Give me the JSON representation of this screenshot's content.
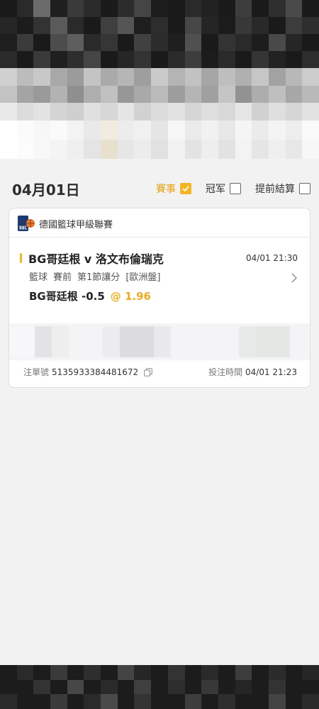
{
  "header": {
    "top_blocks": [
      "#1a1a1a",
      "#2a2a2a",
      "#6b6b6b",
      "#1f1f1f",
      "#3a3a3a",
      "#2b2b2b",
      "#1a1a1a",
      "#2c2c2c",
      "#454545",
      "#1d1d1d",
      "#1a1a1a",
      "#2a2a2a",
      "#222222",
      "#1a1a1a",
      "#3d3d3d",
      "#1a1a1a",
      "#2f2f2f",
      "#4a4a4a",
      "#1a1a1a",
      "#262626",
      "#1c1c1c",
      "#333333",
      "#5a5a5a",
      "#2a2a2a",
      "#1a1a1a",
      "#3f3f3f",
      "#555555",
      "#1e1e1e",
      "#2d2d2d",
      "#1a1a1a",
      "#474747",
      "#252525",
      "#1b1b1b",
      "#383838",
      "#292929",
      "#1a1a1a",
      "#3c3c3c",
      "#2e2e2e",
      "#1e1e1e",
      "#3b3b3b",
      "#1a1a1a",
      "#4c4c4c",
      "#5e5e5e",
      "#2a2a2a",
      "#363636",
      "#1a1a1a",
      "#414141",
      "#2c2c2c",
      "#1f1f1f",
      "#505050",
      "#1a1a1a",
      "#333333",
      "#2a2a2a",
      "#1d1d1d",
      "#494949",
      "#262626",
      "#1a1a1a",
      "#2a2a2a",
      "#1a1a1a",
      "#3a3a3a",
      "#1f1f1f",
      "#2e2e2e",
      "#454545",
      "#1a1a1a",
      "#262626",
      "#333333",
      "#1a1a1a",
      "#2b2b2b",
      "#3d3d3d",
      "#1c1c1c",
      "#2a2a2a",
      "#1a1a1a",
      "#353535",
      "#222222",
      "#1a1a1a",
      "#2d2d2d"
    ],
    "mid_blocks": [
      "#d0d0d0",
      "#bcbcbc",
      "#c8c8c8",
      "#a8a8a8",
      "#9b9b9b",
      "#c4c4c4",
      "#aaaaaa",
      "#b6b6b6",
      "#9e9e9e",
      "#cacaca",
      "#b4b4b4",
      "#c2c2c2",
      "#a6a6a6",
      "#bebebe",
      "#b0b0b0",
      "#c6c6c6",
      "#a2a2a2",
      "#b8b8b8",
      "#cccccc",
      "#c3c3c3",
      "#a4a4a4",
      "#9a9a9a",
      "#b2b2b2",
      "#8f8f8f",
      "#aeaeae",
      "#c0c0c0",
      "#979797",
      "#a9a9a9",
      "#bbbbbb",
      "#9d9d9d",
      "#b5b5b5",
      "#a0a0a0",
      "#c5c5c5",
      "#929292",
      "#adadad",
      "#bfbfbf",
      "#a7a7a7",
      "#b9b9b9",
      "#e9e9e9",
      "#dcdcdc",
      "#e3e3e3",
      "#d4d4d4",
      "#cfcfcf",
      "#e0e0e0",
      "#d7d7d7",
      "#e5e5e5",
      "#d2d2d2",
      "#dbdbdb",
      "#e1e1e1",
      "#d5d5d5",
      "#dedede",
      "#d9d9d9",
      "#e6e6e6",
      "#d1d1d1",
      "#dfdfdf",
      "#d6d6d6",
      "#e2e2e2"
    ],
    "low_blocks": [
      "#ffffff",
      "#fbfbfb",
      "#f7f7f7",
      "#fafafa",
      "#f3f3f3",
      "#e9e9e9",
      "#f2ece0",
      "#ececec",
      "#f0f0f0",
      "#e5e5e5",
      "#f6f6f6",
      "#eaeaea",
      "#f1f1f1",
      "#e8e8e8",
      "#f5f5f5",
      "#ebebeb",
      "#f4f4f4",
      "#ededed",
      "#f9f9f9",
      "#ffffff",
      "#fcfcfc",
      "#f8f8f8",
      "#f4f4f4",
      "#efefef",
      "#e4e4e4",
      "#e8dfcc",
      "#e6e6e6",
      "#ececec",
      "#e1e1e1",
      "#f2f2f2",
      "#e3e3e3",
      "#eeeeee",
      "#e2e2e2",
      "#f3f3f3",
      "#e5e5e5",
      "#efefef",
      "#e7e7e7",
      "#f7f7f7"
    ],
    "bottom_blocks": [
      "#1c1c1c",
      "#2a2a2a",
      "#1c1c1c",
      "#3a3a3a",
      "#1c1c1c",
      "#2e2e2e",
      "#1c1c1c",
      "#444444",
      "#262626",
      "#1c1c1c",
      "#333333",
      "#1c1c1c",
      "#2a2a2a",
      "#1c1c1c",
      "#3d3d3d",
      "#1c1c1c",
      "#2b2b2b",
      "#1c1c1c",
      "#262626",
      "#1c1c1c",
      "#1c1c1c",
      "#333333",
      "#1c1c1c",
      "#474747",
      "#1c1c1c",
      "#2a2a2a",
      "#1c1c1c",
      "#3f3f3f",
      "#1c1c1c",
      "#2d2d2d",
      "#1c1c1c",
      "#383838",
      "#1c1c1c",
      "#262626",
      "#1c1c1c",
      "#333333",
      "#1c1c1c",
      "#1c1c1c",
      "#2a2a2a",
      "#1c1c1c",
      "#1c1c1c",
      "#3a3a3a",
      "#1c1c1c",
      "#2a2a2a",
      "#4a4a4a",
      "#1c1c1c",
      "#333333",
      "#1c1c1c",
      "#1c1c1c",
      "#3d3d3d",
      "#1c1c1c",
      "#2e2e2e",
      "#1c1c1c",
      "#1c1c1c",
      "#444444",
      "#1c1c1c",
      "#2a2a2a"
    ]
  },
  "date_header": {
    "date": "04月01日",
    "filters": [
      {
        "label": "賽事",
        "checked": true
      },
      {
        "label": "冠军",
        "checked": false
      },
      {
        "label": "提前結算",
        "checked": false
      }
    ]
  },
  "bet_card": {
    "league_name": "德國籃球甲級聯賽",
    "league_logo_text": "BBL",
    "match_title": "BG哥廷根 v 洛文布倫瑞克",
    "match_time": "04/01 21:30",
    "sport": "籃球",
    "stage": "賽前",
    "market": "第1節讓分",
    "odds_type": "[歐洲盤]",
    "selection": "BG哥廷根 -0.5",
    "odds": "@ 1.96",
    "bet_id_label": "注單號",
    "bet_id": "5135933384481672",
    "bet_time_label": "投注時間",
    "bet_time": "04/01 21:23"
  },
  "colors": {
    "accent": "#f5b522",
    "odds": "#f0ac1c",
    "background": "#f2f2f2"
  }
}
